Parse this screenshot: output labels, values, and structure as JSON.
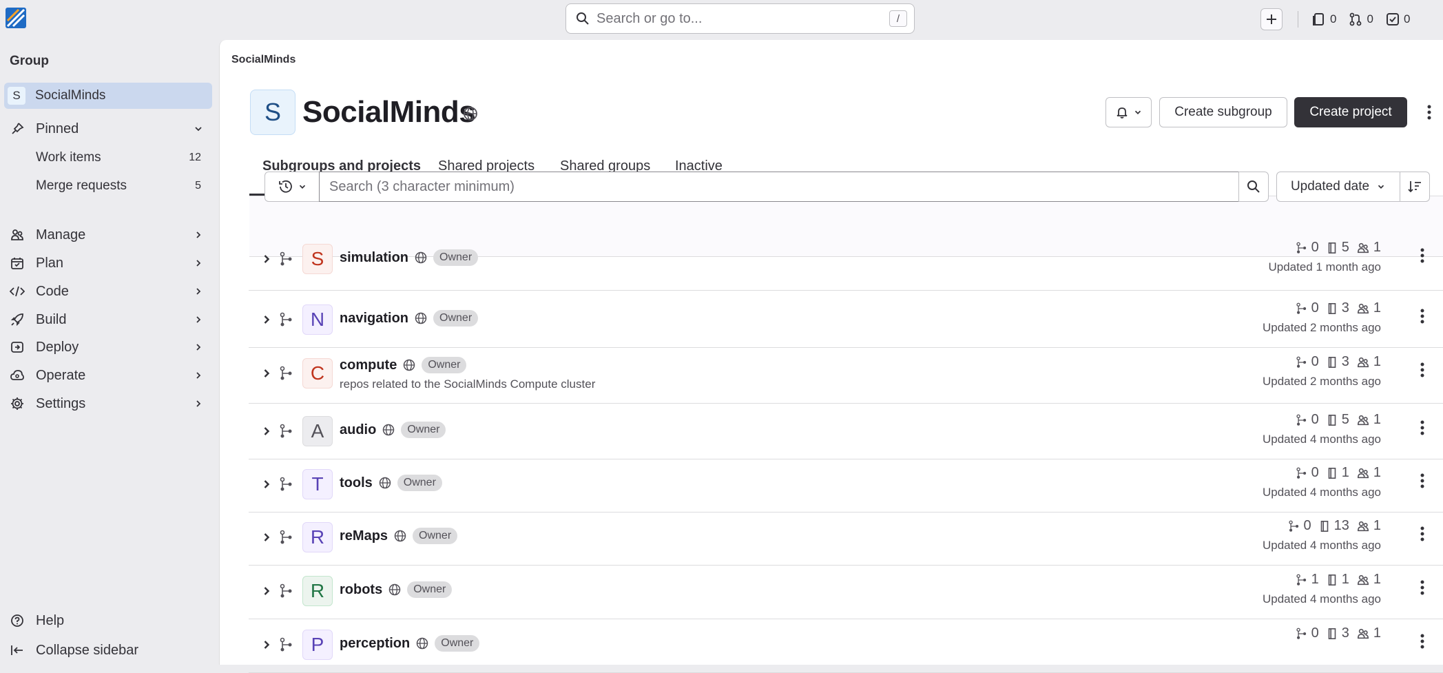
{
  "topbar": {
    "search_placeholder": "Search or go to...",
    "search_shortcut": "/",
    "issues_count": "0",
    "merge_requests_count": "0",
    "todos_count": "0"
  },
  "sidebar": {
    "context_title": "Group",
    "group_avatar_letter": "S",
    "group_name": "SocialMinds",
    "pinned_label": "Pinned",
    "pinned_items": [
      {
        "label": "Work items",
        "count": "12"
      },
      {
        "label": "Merge requests",
        "count": "5"
      }
    ],
    "nav_items": [
      {
        "label": "Manage",
        "icon": "users-icon"
      },
      {
        "label": "Plan",
        "icon": "calendar-icon"
      },
      {
        "label": "Code",
        "icon": "code-icon"
      },
      {
        "label": "Build",
        "icon": "rocket-icon"
      },
      {
        "label": "Deploy",
        "icon": "deployments-icon"
      },
      {
        "label": "Operate",
        "icon": "cloud-icon"
      },
      {
        "label": "Settings",
        "icon": "gear-icon"
      }
    ],
    "help_label": "Help",
    "collapse_label": "Collapse sidebar"
  },
  "main": {
    "breadcrumb": "SocialMinds",
    "group_avatar_letter": "S",
    "group_title": "SocialMinds",
    "create_subgroup_label": "Create subgroup",
    "create_project_label": "Create project",
    "tabs": [
      {
        "label": "Subgroups and projects",
        "active": true
      },
      {
        "label": "Shared projects",
        "active": false
      },
      {
        "label": "Shared groups",
        "active": false
      },
      {
        "label": "Inactive",
        "active": false
      }
    ],
    "filter_placeholder": "Search (3 character minimum)",
    "sort_label": "Updated date"
  },
  "rows": [
    {
      "letter": "S",
      "name": "simulation",
      "role": "Owner",
      "description": "",
      "subgroups": "0",
      "projects": "5",
      "members": "1",
      "updated": "Updated 1 month ago",
      "avatar_bg": "#fcf1ef",
      "avatar_fg": "#c0341d",
      "avatar_border": "#f5d9d4"
    },
    {
      "letter": "N",
      "name": "navigation",
      "role": "Owner",
      "description": "",
      "subgroups": "0",
      "projects": "3",
      "members": "1",
      "updated": "Updated 2 months ago",
      "avatar_bg": "#f4f0ff",
      "avatar_fg": "#5943b6",
      "avatar_border": "#e1d8f9"
    },
    {
      "letter": "C",
      "name": "compute",
      "role": "Owner",
      "description": "repos related to the SocialMinds Compute cluster",
      "subgroups": "0",
      "projects": "3",
      "members": "1",
      "updated": "Updated 2 months ago",
      "avatar_bg": "#fcf1ef",
      "avatar_fg": "#c0341d",
      "avatar_border": "#f5d9d4"
    },
    {
      "letter": "A",
      "name": "audio",
      "role": "Owner",
      "description": "",
      "subgroups": "0",
      "projects": "5",
      "members": "1",
      "updated": "Updated 4 months ago",
      "avatar_bg": "#ececef",
      "avatar_fg": "#535158",
      "avatar_border": "#dcdcde"
    },
    {
      "letter": "T",
      "name": "tools",
      "role": "Owner",
      "description": "",
      "subgroups": "0",
      "projects": "1",
      "members": "1",
      "updated": "Updated 4 months ago",
      "avatar_bg": "#f4f0ff",
      "avatar_fg": "#5943b6",
      "avatar_border": "#e1d8f9"
    },
    {
      "letter": "R",
      "name": "reMaps",
      "role": "Owner",
      "description": "",
      "subgroups": "0",
      "projects": "13",
      "members": "1",
      "updated": "Updated 4 months ago",
      "avatar_bg": "#f4f0ff",
      "avatar_fg": "#5943b6",
      "avatar_border": "#e1d8f9"
    },
    {
      "letter": "R",
      "name": "robots",
      "role": "Owner",
      "description": "",
      "subgroups": "1",
      "projects": "1",
      "members": "1",
      "updated": "Updated 4 months ago",
      "avatar_bg": "#ecf4ee",
      "avatar_fg": "#217645",
      "avatar_border": "#c3e6cd"
    },
    {
      "letter": "P",
      "name": "perception",
      "role": "Owner",
      "description": "",
      "subgroups": "0",
      "projects": "3",
      "members": "1",
      "updated": "",
      "avatar_bg": "#f4f0ff",
      "avatar_fg": "#5943b6",
      "avatar_border": "#e1d8f9"
    }
  ]
}
